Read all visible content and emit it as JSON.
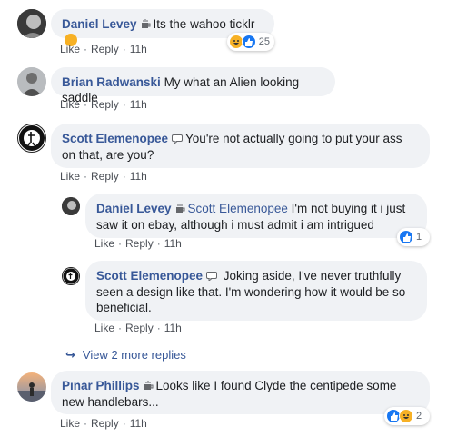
{
  "colors": {
    "link": "#385898",
    "bubble": "#f0f2f5",
    "like": "#1877f2",
    "haha": "#f7b125"
  },
  "actions": {
    "like": "Like",
    "reply": "Reply",
    "dot": "·"
  },
  "comments": [
    {
      "author": "Daniel Levey",
      "text": "Its the wahoo ticklr",
      "emoji": "rolling-laughing-emoji",
      "time": "11h",
      "reactions": {
        "count": "25",
        "types": [
          "haha",
          "like"
        ]
      }
    },
    {
      "author": "Brian Radwanski",
      "text": "My what an Alien looking saddle",
      "time": "11h"
    },
    {
      "author": "Scott Elemenopee",
      "text": "You're not actually going to put your ass on that, are you?",
      "time": "11h",
      "replies": [
        {
          "author": "Daniel Levey",
          "mention": "Scott Elemenopee",
          "text": "I'm not buying it i just saw it on ebay, although i must admit i am intrigued",
          "time": "11h",
          "reactions": {
            "count": "1",
            "types": [
              "like"
            ]
          }
        },
        {
          "author": "Scott Elemenopee",
          "text": "Joking aside, I've never truthfully seen a design like that. I'm wondering how it would be so beneficial.",
          "time": "11h"
        }
      ],
      "more_replies": "View 2 more replies"
    },
    {
      "author": "Pınar Phillips",
      "text": "Looks like I found Clyde the centipede some new handlebars...",
      "time": "11h",
      "reactions": {
        "count": "2",
        "types": [
          "like",
          "haha"
        ]
      }
    }
  ]
}
